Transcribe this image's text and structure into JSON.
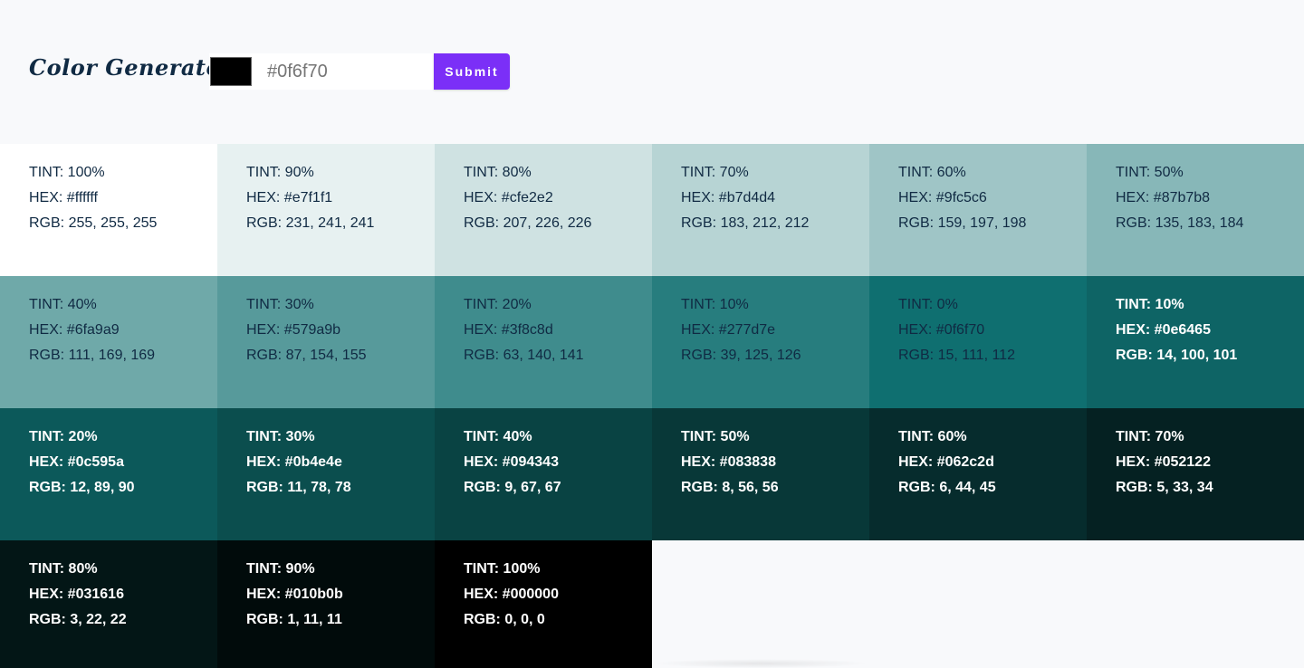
{
  "app": {
    "title": "Color Generator"
  },
  "form": {
    "swatch_color": "#000000",
    "hex_placeholder": "#0f6f70",
    "submit_label": "Submit",
    "accent": "#7b2ff7"
  },
  "tiles": [
    {
      "tint": "TINT: 100%",
      "hex": "HEX: #ffffff",
      "rgb": "RGB: 255, 255, 255",
      "bg": "#ffffff",
      "theme": "light"
    },
    {
      "tint": "TINT: 90%",
      "hex": "HEX: #e7f1f1",
      "rgb": "RGB: 231, 241, 241",
      "bg": "#e7f1f1",
      "theme": "light"
    },
    {
      "tint": "TINT: 80%",
      "hex": "HEX: #cfe2e2",
      "rgb": "RGB: 207, 226, 226",
      "bg": "#cfe2e2",
      "theme": "light"
    },
    {
      "tint": "TINT: 70%",
      "hex": "HEX: #b7d4d4",
      "rgb": "RGB: 183, 212, 212",
      "bg": "#b7d4d4",
      "theme": "light"
    },
    {
      "tint": "TINT: 60%",
      "hex": "HEX: #9fc5c6",
      "rgb": "RGB: 159, 197, 198",
      "bg": "#9fc5c6",
      "theme": "light"
    },
    {
      "tint": "TINT: 50%",
      "hex": "HEX: #87b7b8",
      "rgb": "RGB: 135, 183, 184",
      "bg": "#87b7b8",
      "theme": "light"
    },
    {
      "tint": "TINT: 40%",
      "hex": "HEX: #6fa9a9",
      "rgb": "RGB: 111, 169, 169",
      "bg": "#6fa9a9",
      "theme": "light"
    },
    {
      "tint": "TINT: 30%",
      "hex": "HEX: #579a9b",
      "rgb": "RGB: 87, 154, 155",
      "bg": "#579a9b",
      "theme": "light"
    },
    {
      "tint": "TINT: 20%",
      "hex": "HEX: #3f8c8d",
      "rgb": "RGB: 63, 140, 141",
      "bg": "#3f8c8d",
      "theme": "light"
    },
    {
      "tint": "TINT: 10%",
      "hex": "HEX: #277d7e",
      "rgb": "RGB: 39, 125, 126",
      "bg": "#277d7e",
      "theme": "light"
    },
    {
      "tint": "TINT: 0%",
      "hex": "HEX: #0f6f70",
      "rgb": "RGB: 15, 111, 112",
      "bg": "#0f6f70",
      "theme": "light"
    },
    {
      "tint": "TINT: 10%",
      "hex": "HEX: #0e6465",
      "rgb": "RGB: 14, 100, 101",
      "bg": "#0e6465",
      "theme": "dark"
    },
    {
      "tint": "TINT: 20%",
      "hex": "HEX: #0c595a",
      "rgb": "RGB: 12, 89, 90",
      "bg": "#0c595a",
      "theme": "dark"
    },
    {
      "tint": "TINT: 30%",
      "hex": "HEX: #0b4e4e",
      "rgb": "RGB: 11, 78, 78",
      "bg": "#0b4e4e",
      "theme": "dark"
    },
    {
      "tint": "TINT: 40%",
      "hex": "HEX: #094343",
      "rgb": "RGB: 9, 67, 67",
      "bg": "#094343",
      "theme": "dark"
    },
    {
      "tint": "TINT: 50%",
      "hex": "HEX: #083838",
      "rgb": "RGB: 8, 56, 56",
      "bg": "#083838",
      "theme": "dark"
    },
    {
      "tint": "TINT: 60%",
      "hex": "HEX: #062c2d",
      "rgb": "RGB: 6, 44, 45",
      "bg": "#062c2d",
      "theme": "dark"
    },
    {
      "tint": "TINT: 70%",
      "hex": "HEX: #052122",
      "rgb": "RGB: 5, 33, 34",
      "bg": "#052122",
      "theme": "dark"
    },
    {
      "tint": "TINT: 80%",
      "hex": "HEX: #031616",
      "rgb": "RGB: 3, 22, 22",
      "bg": "#031616",
      "theme": "dark"
    },
    {
      "tint": "TINT: 90%",
      "hex": "HEX: #010b0b",
      "rgb": "RGB: 1, 11, 11",
      "bg": "#010b0b",
      "theme": "dark"
    },
    {
      "tint": "TINT: 100%",
      "hex": "HEX: #000000",
      "rgb": "RGB: 0, 0, 0",
      "bg": "#000000",
      "theme": "dark"
    }
  ]
}
